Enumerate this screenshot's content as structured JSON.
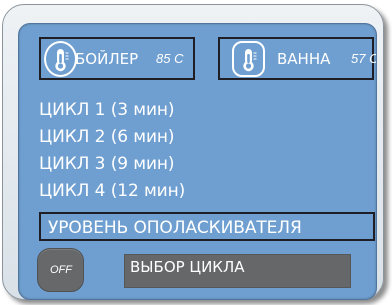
{
  "colors": {
    "screen": "#6f9fd0",
    "text": "#ffffff",
    "button": "#656769",
    "frame_outline": "#1e1e24"
  },
  "sensors": {
    "boiler": {
      "label": "БОЙЛЕР",
      "value": "85 С",
      "icon": "thermometer-icon"
    },
    "bath": {
      "label": "ВАННА",
      "value": "57 С",
      "icon": "thermometer-icon"
    }
  },
  "cycles": [
    "ЦИКЛ 1 (3 мин)",
    "ЦИКЛ 2 (6 мин)",
    "ЦИКЛ 3 (9 мин)",
    "ЦИКЛ 4 (12 мин)"
  ],
  "rinse_level": {
    "label": "УРОВЕНЬ ОПОЛАСКИВАТЕЛЯ"
  },
  "buttons": {
    "off": "OFF",
    "select_cycle": "ВЫБОР ЦИКЛА"
  }
}
